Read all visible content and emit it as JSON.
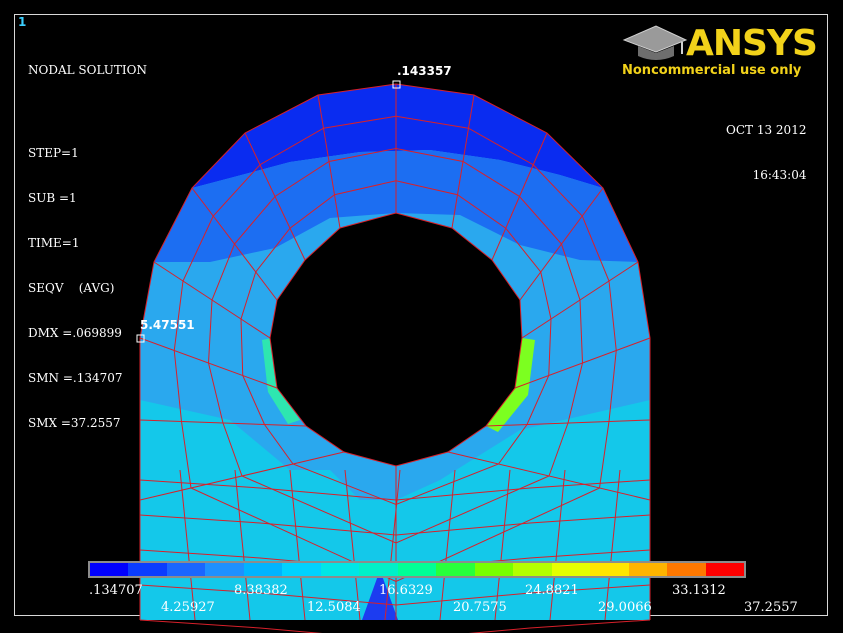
{
  "window_number": "1",
  "info": {
    "title": "NODAL SOLUTION",
    "step": "STEP=1",
    "sub": "SUB =1",
    "time": "TIME=1",
    "seqv": "SEQV    (AVG)",
    "dmx": "DMX =.069899",
    "smn": "SMN =.134707",
    "smx": "SMX =37.2557"
  },
  "logo": {
    "word": "ANSYS",
    "subtitle": "Noncommercial use only",
    "icon": "graduation-cap-icon",
    "color": "#f2d21a"
  },
  "timestamp": {
    "date": "OCT 13 2012",
    "time": "16:43:04"
  },
  "probes": {
    "max_label": ".143357",
    "min_label": "5.47551"
  },
  "legend": {
    "colors": [
      "#0000ff",
      "#0a3cff",
      "#1a66ff",
      "#1e90ff",
      "#00b4ff",
      "#00d2ff",
      "#00e6e6",
      "#00f0c8",
      "#00ff96",
      "#28ff3c",
      "#78ff00",
      "#b4ff00",
      "#e6ff00",
      "#ffe600",
      "#ffb400",
      "#ff7800",
      "#ff0000"
    ],
    "labels_top": [
      ".134707",
      "8.38382",
      "16.6329",
      "24.8821",
      "33.1312"
    ],
    "labels_bottom": [
      "4.25927",
      "12.5084",
      "20.7575",
      "29.0066",
      "37.2557"
    ]
  },
  "colors": {
    "mesh_line": "#d8202a",
    "region_blue": "#0a2cf0",
    "region_mid": "#1c6ef2",
    "region_light": "#2aa8ee",
    "region_cyan": "#14c8ea",
    "region_green": "#2ee6b0"
  }
}
